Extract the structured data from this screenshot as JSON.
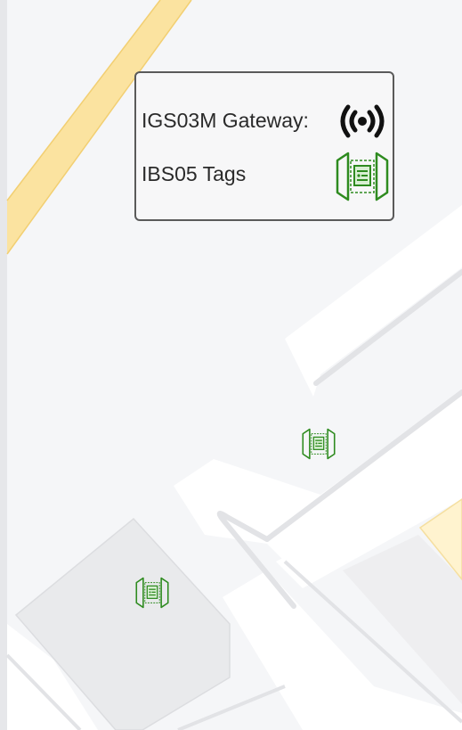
{
  "legend": {
    "gateway_label": "IGS03M Gateway:",
    "tag_label": "IBS05 Tags",
    "gateway_icon": "radio-broadcast-icon",
    "tag_icon": "beacon-tag-icon"
  },
  "map": {
    "road_color": "#fbe6a4",
    "tag_color": "#2e8b1f",
    "background_color": "#f5f6f8"
  },
  "markers": [
    {
      "type": "IBS05 Tag",
      "icon": "beacon-tag-icon"
    },
    {
      "type": "IBS05 Tag",
      "icon": "beacon-tag-icon"
    }
  ]
}
